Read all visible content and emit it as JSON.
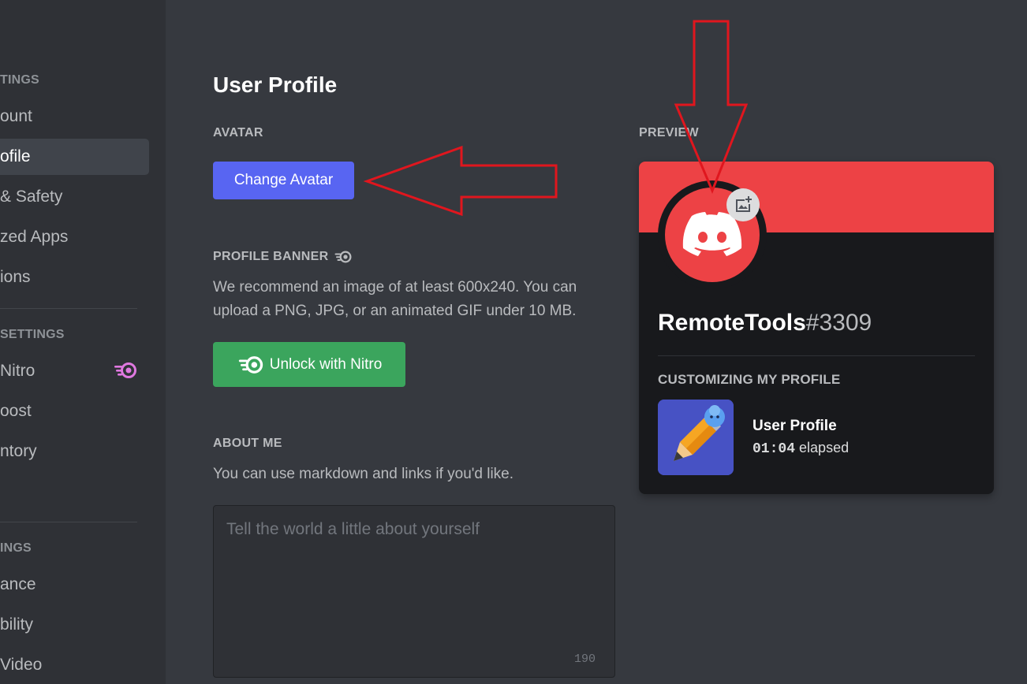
{
  "sidebar": {
    "groups": [
      {
        "header": "TINGS",
        "items": [
          "ount",
          "ofile",
          "& Safety",
          "zed Apps",
          "ions"
        ]
      },
      {
        "header": "SETTINGS",
        "items": [
          "Nitro",
          "oost",
          "ntory"
        ]
      },
      {
        "header": "INGS",
        "items": [
          "ance",
          "bility",
          "Video"
        ]
      }
    ],
    "active_item": "ofile"
  },
  "main": {
    "title": "User Profile",
    "avatar": {
      "label": "AVATAR",
      "button": "Change Avatar"
    },
    "banner": {
      "label": "PROFILE BANNER",
      "description": "We recommend an image of at least 600x240. You can upload a PNG, JPG, or an animated GIF under 10 MB.",
      "button": "Unlock with Nitro"
    },
    "about": {
      "label": "ABOUT ME",
      "description": "You can use markdown and links if you'd like.",
      "placeholder": "Tell the world a little about yourself",
      "char_count": "190"
    }
  },
  "preview": {
    "label": "PREVIEW",
    "username": "RemoteTools",
    "discriminator": "#3309",
    "activity_header": "CUSTOMIZING MY PROFILE",
    "activity_title": "User Profile",
    "elapsed_time": "01:04",
    "elapsed_suffix": "elapsed"
  },
  "colors": {
    "blurple": "#5865f2",
    "green": "#3ba55d",
    "red": "#ed4245",
    "nitro_pink": "#e078e0",
    "annotation_arrow": "#e0161e"
  },
  "icons": [
    "nitro-icon",
    "discord-logo-icon",
    "add-image-icon",
    "pencil-activity-icon"
  ]
}
